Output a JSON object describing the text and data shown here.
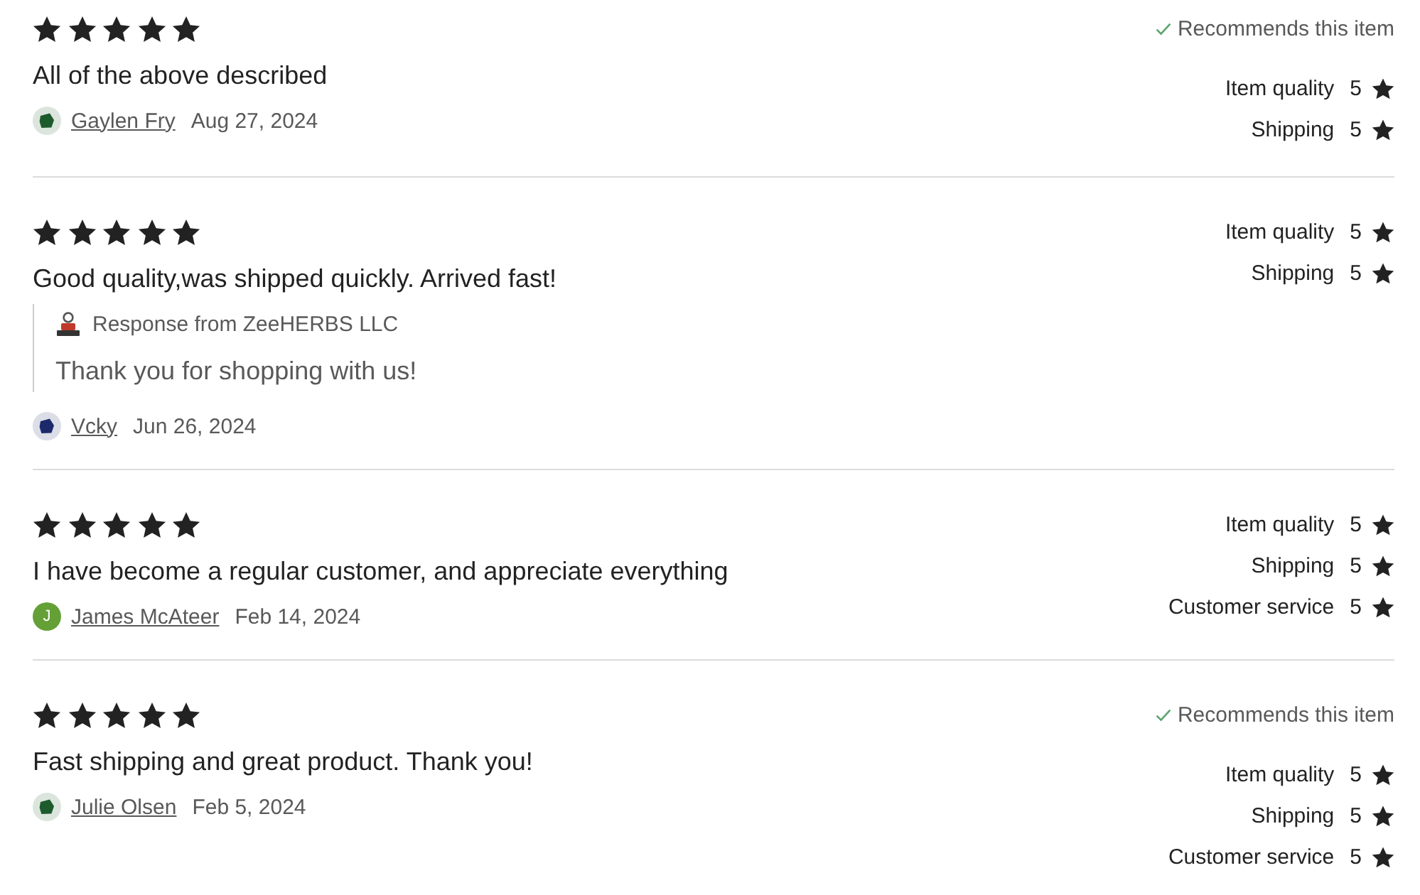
{
  "reviews": [
    {
      "stars": 5,
      "text": "All of the above described",
      "avatar": {
        "kind": "picture",
        "color": "#1d5b2c"
      },
      "author": "Gaylen Fry",
      "date": "Aug 27, 2024",
      "recommends": true,
      "recommend_label": "Recommends this item",
      "ratings": [
        {
          "label": "Item quality",
          "value": "5"
        },
        {
          "label": "Shipping",
          "value": "5"
        }
      ]
    },
    {
      "stars": 5,
      "text": "Good quality,was shipped quickly. Arrived fast!",
      "response": {
        "title": "Response from ZeeHERBS LLC",
        "text": "Thank you for shopping with us!"
      },
      "avatar": {
        "kind": "picture",
        "color": "#1c2a6b"
      },
      "author": "Vcky",
      "date": "Jun 26, 2024",
      "recommends": false,
      "ratings": [
        {
          "label": "Item quality",
          "value": "5"
        },
        {
          "label": "Shipping",
          "value": "5"
        }
      ]
    },
    {
      "stars": 5,
      "text": "I have become a regular customer, and appreciate everything",
      "avatar": {
        "kind": "initial",
        "initial": "J",
        "color": "#64a036"
      },
      "author": "James McAteer",
      "date": "Feb 14, 2024",
      "recommends": false,
      "ratings": [
        {
          "label": "Item quality",
          "value": "5"
        },
        {
          "label": "Shipping",
          "value": "5"
        },
        {
          "label": "Customer service",
          "value": "5"
        }
      ]
    },
    {
      "stars": 5,
      "text": "Fast shipping and great product. Thank you!",
      "avatar": {
        "kind": "picture",
        "color": "#1d5b2c"
      },
      "author": "Julie Olsen",
      "date": "Feb 5, 2024",
      "recommends": true,
      "recommend_label": "Recommends this item",
      "ratings": [
        {
          "label": "Item quality",
          "value": "5"
        },
        {
          "label": "Shipping",
          "value": "5"
        },
        {
          "label": "Customer service",
          "value": "5"
        }
      ]
    }
  ]
}
